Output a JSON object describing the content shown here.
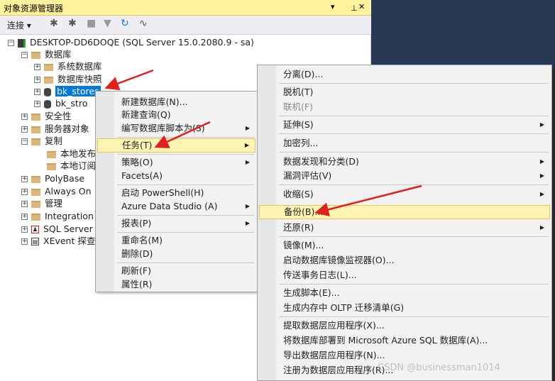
{
  "panel": {
    "title": "对象资源管理器",
    "title_controls": [
      "▾",
      "ᅟ",
      "✕"
    ],
    "toolbar": {
      "connect_label": "连接 ▾"
    }
  },
  "tree": {
    "server": "DESKTOP-DD6DOQE (SQL Server 15.0.2080.9 - sa)",
    "databases": "数据库",
    "system_dbs": "系统数据库",
    "snapshots": "数据库快照",
    "db1": "bk_stores",
    "db2": "bk_stro",
    "security": "安全性",
    "server_objects": "服务器对象",
    "replication": "复制",
    "local_pub": "本地发布",
    "local_sub": "本地订阅",
    "polybase": "PolyBase",
    "always_on": "Always On",
    "management": "管理",
    "integration": "Integration",
    "sql_agent": "SQL Server",
    "xevent": "XEvent 探查"
  },
  "menu1": [
    {
      "label": "新建数据库(N)..."
    },
    {
      "label": "新建查询(Q)"
    },
    {
      "label": "编写数据库脚本为(S)",
      "sub": true
    },
    {
      "label": "任务(T)",
      "sub": true,
      "highlight": true
    },
    {
      "label": "策略(O)",
      "sub": true
    },
    {
      "label": "Facets(A)"
    },
    {
      "label": "启动 PowerShell(H)"
    },
    {
      "label": "Azure Data Studio (A)",
      "sub": true
    },
    {
      "label": "报表(P)",
      "sub": true
    },
    {
      "label": "重命名(M)"
    },
    {
      "label": "删除(D)"
    },
    {
      "label": "刷新(F)"
    },
    {
      "label": "属性(R)"
    }
  ],
  "menu2": [
    {
      "label": "分离(D)..."
    },
    {
      "label": "脱机(T)"
    },
    {
      "label": "联机(F)",
      "disabled": true
    },
    {
      "label": "延伸(S)",
      "sub": true
    },
    {
      "label": "加密列..."
    },
    {
      "label": "数据发现和分类(D)",
      "sub": true
    },
    {
      "label": "漏洞评估(V)",
      "sub": true
    },
    {
      "label": "收缩(S)",
      "sub": true
    },
    {
      "label": "备份(B)...",
      "highlight": true
    },
    {
      "label": "还原(R)",
      "sub": true
    },
    {
      "label": "镜像(M)..."
    },
    {
      "label": "启动数据库镜像监视器(O)..."
    },
    {
      "label": "传送事务日志(L)..."
    },
    {
      "label": "生成脚本(E)..."
    },
    {
      "label": "生成内存中 OLTP 迁移清单(G)"
    },
    {
      "label": "提取数据层应用程序(X)..."
    },
    {
      "label": "将数据库部署到 Microsoft Azure SQL 数据库(A)..."
    },
    {
      "label": "导出数据层应用程序(N)..."
    },
    {
      "label": "注册为数据层应用程序(R)..."
    }
  ],
  "watermark": "CSDN @businessman1014",
  "colors": {
    "highlight": "#fff5b3",
    "selection": "#0078d7",
    "arrow": "#e0201c",
    "titlebar": "#fff29d"
  }
}
